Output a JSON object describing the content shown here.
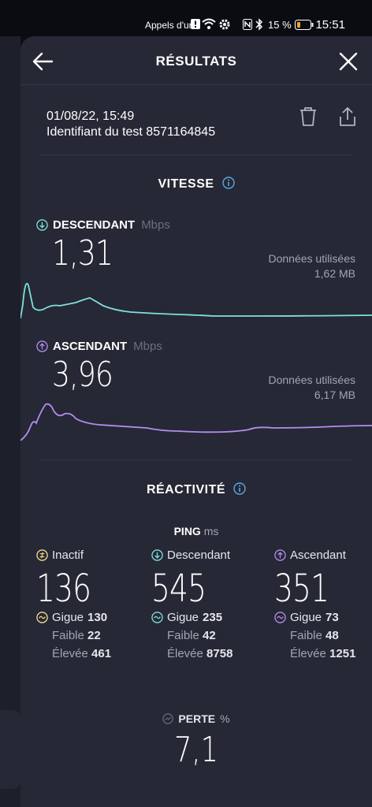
{
  "status_bar": {
    "carrier_text": "Appels d'ur",
    "battery": "15 %",
    "time": "15:51"
  },
  "header": {
    "title": "RÉSULTATS"
  },
  "test": {
    "datetime": "01/08/22, 15:49",
    "test_id": "Identifiant du test 8571164845"
  },
  "speed": {
    "title": "VITESSE",
    "download": {
      "label": "DESCENDANT",
      "unit": "Mbps",
      "value": "1,31",
      "data_used_label": "Données utilisées",
      "data_used": "1,62 MB"
    },
    "upload": {
      "label": "ASCENDANT",
      "unit": "Mbps",
      "value": "3,96",
      "data_used_label": "Données utilisées",
      "data_used": "6,17 MB"
    }
  },
  "responsiveness": {
    "title": "RÉACTIVITÉ",
    "ping_label": "PING",
    "ping_unit": "ms",
    "columns": [
      {
        "label": "Inactif",
        "value": "136",
        "jitter_label": "Gigue",
        "jitter": "130",
        "low_label": "Faible",
        "low": "22",
        "high_label": "Élevée",
        "high": "461"
      },
      {
        "label": "Descendant",
        "value": "545",
        "jitter_label": "Gigue",
        "jitter": "235",
        "low_label": "Faible",
        "low": "42",
        "high_label": "Élevée",
        "high": "8758"
      },
      {
        "label": "Ascendant",
        "value": "351",
        "jitter_label": "Gigue",
        "jitter": "73",
        "low_label": "Faible",
        "low": "48",
        "high_label": "Élevée",
        "high": "1251"
      }
    ],
    "loss_label": "PERTE",
    "loss_unit": "%",
    "loss_value": "7,1"
  },
  "colors": {
    "download": "#7fe0de",
    "upload": "#b58cf0",
    "idle": "#f3dc8a",
    "info": "#5aa8e6"
  }
}
